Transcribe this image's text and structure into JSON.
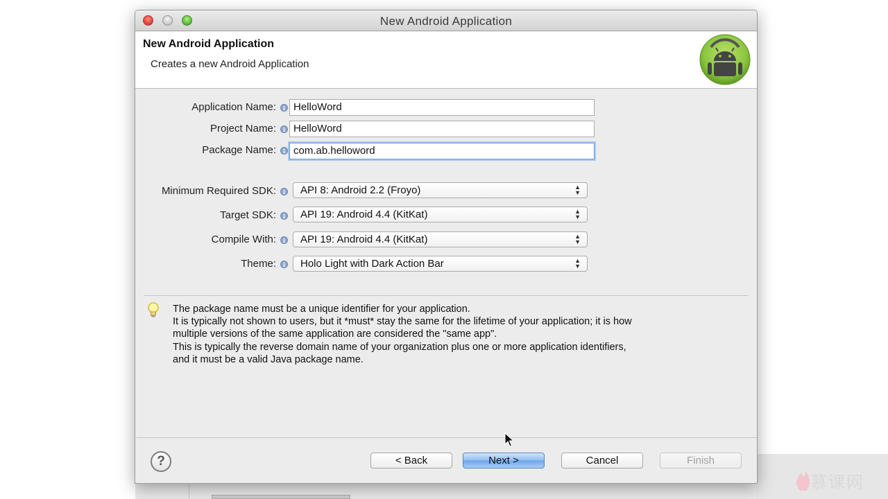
{
  "window": {
    "title": "New Android Application"
  },
  "header": {
    "title": "New Android Application",
    "description": "Creates a new Android Application",
    "logo_icon": "android-logo-icon"
  },
  "form": {
    "application_name": {
      "label": "Application Name:",
      "value": "HelloWord"
    },
    "project_name": {
      "label": "Project Name:",
      "value": "HelloWord"
    },
    "package_name": {
      "label": "Package Name:",
      "value": "com.ab.helloword"
    },
    "min_sdk": {
      "label": "Minimum Required SDK:",
      "selected": "API 8: Android 2.2 (Froyo)"
    },
    "target_sdk": {
      "label": "Target SDK:",
      "selected": "API 19: Android 4.4 (KitKat)"
    },
    "compile_with": {
      "label": "Compile With:",
      "selected": "API 19: Android 4.4 (KitKat)"
    },
    "theme": {
      "label": "Theme:",
      "selected": "Holo Light with Dark Action Bar"
    }
  },
  "info_icon_glyph": "i",
  "help_text": {
    "icon": "lightbulb-icon",
    "lines": [
      "The package name must be a unique identifier for your application.",
      "It is typically not shown to users, but it *must* stay the same for the lifetime of your application; it is how",
      "multiple versions of the same application are considered the \"same app\".",
      "This is typically the reverse domain name of your organization plus one or more application identifiers,",
      "and it must be a valid Java package name."
    ]
  },
  "buttons": {
    "help": "?",
    "back": "< Back",
    "next": "Next >",
    "cancel": "Cancel",
    "finish": "Finish"
  },
  "watermark": {
    "text": "慕课网"
  },
  "colors": {
    "android_green": "#8cc63f",
    "primary_button": "#6ba6ea",
    "focus_ring": "#a9c8f0"
  }
}
